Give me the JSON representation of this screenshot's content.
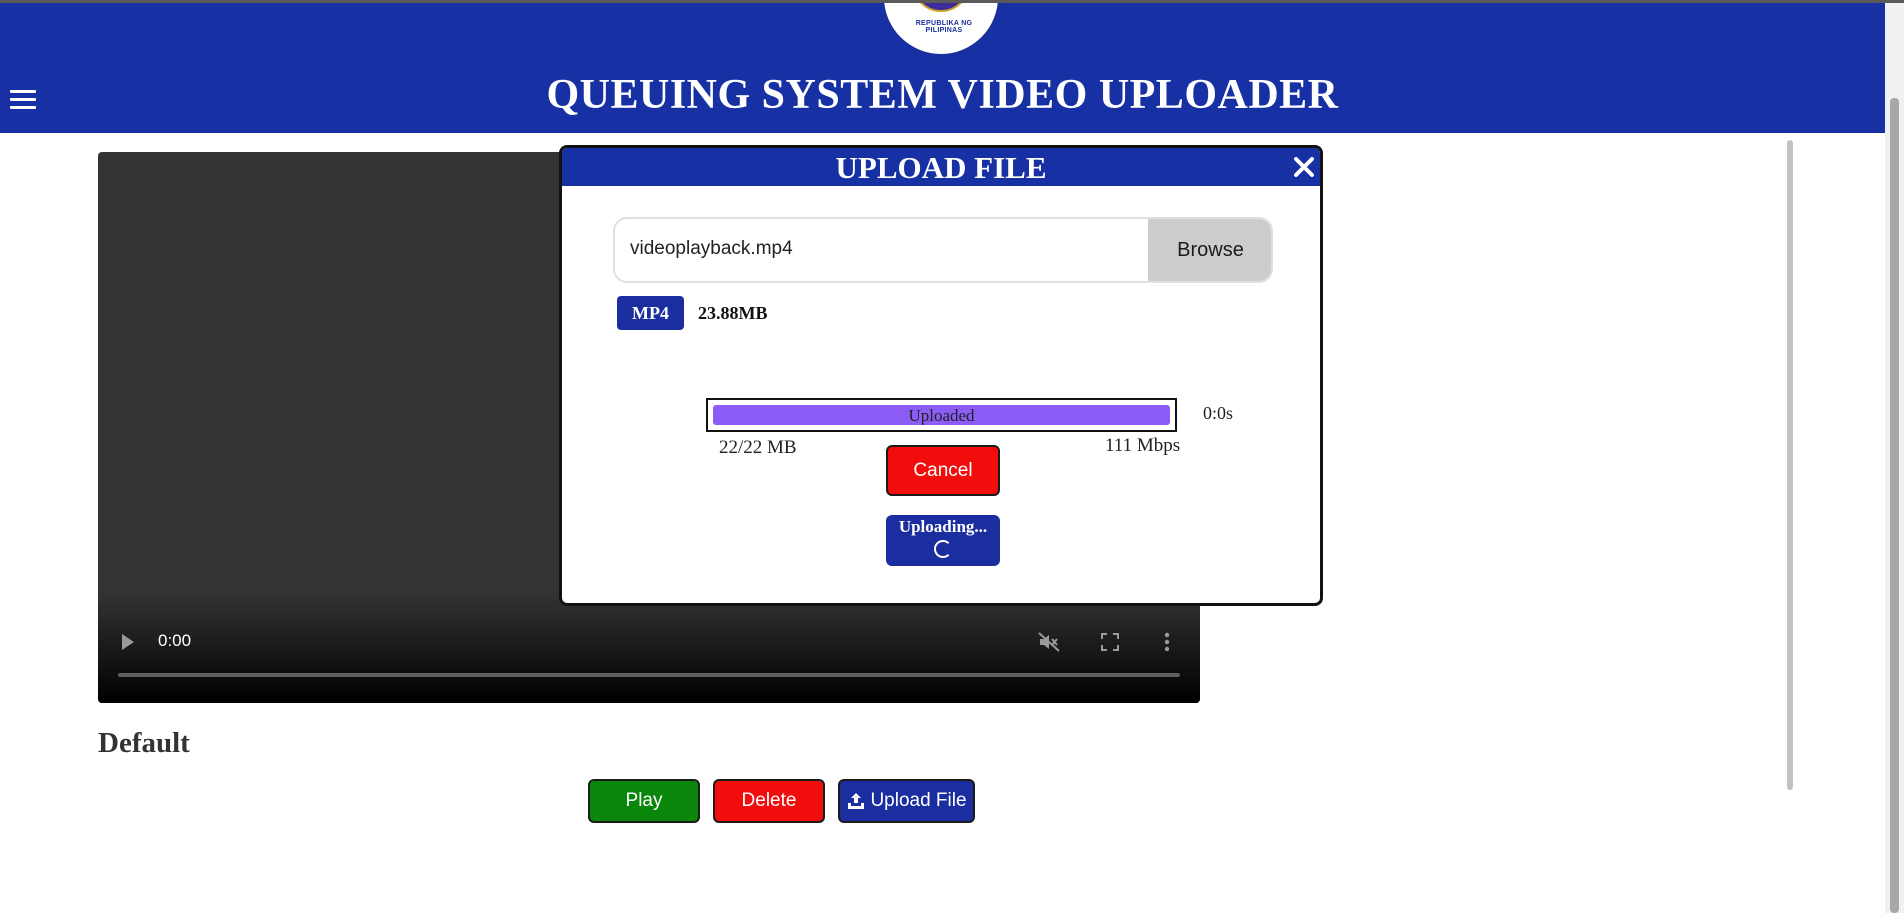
{
  "header": {
    "title": "QUEUING SYSTEM VIDEO UPLOADER",
    "logo_text": "REPUBLIKA NG PILIPINAS",
    "background_color": "#1730a3",
    "menu_icon": "hamburger-menu-icon"
  },
  "video_player": {
    "current_time": "0:00",
    "play_icon": "play-icon",
    "volume_icon": "muted-volume-icon",
    "fullscreen_icon": "fullscreen-icon",
    "more_icon": "more-options-icon"
  },
  "playlist": {
    "name": "Default"
  },
  "actions": {
    "play_label": "Play",
    "delete_label": "Delete",
    "upload_label": "Upload File",
    "upload_icon": "upload-icon",
    "play_color": "#0a860a",
    "delete_color": "#f20d0d",
    "upload_color": "#1b2e9f"
  },
  "upload_modal": {
    "title": "UPLOAD FILE",
    "close_icon": "close-icon",
    "file_name": "videoplayback.mp4",
    "browse_label": "Browse",
    "file_type": "MP4",
    "file_size": "23.88MB",
    "progress": {
      "label": "Uploaded",
      "percent": 100,
      "fill_color": "#8b5cf6",
      "elapsed": "0:0s",
      "transferred": "22/22 MB",
      "speed": "111 Mbps"
    },
    "cancel_label": "Cancel",
    "uploading_label": "Uploading...",
    "spinner_icon": "loading-spinner-icon"
  }
}
